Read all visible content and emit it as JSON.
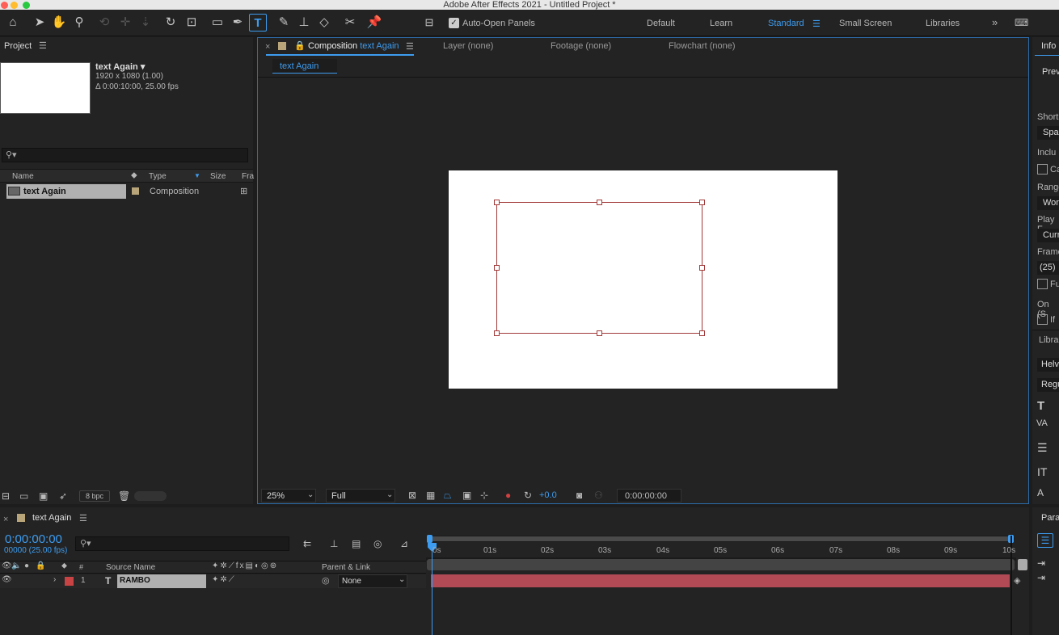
{
  "window": {
    "title": "Adobe After Effects 2021 - Untitled Project *"
  },
  "toolbar": {
    "auto_open_label": "Auto-Open Panels",
    "workspaces": [
      "Default",
      "Learn",
      "Standard",
      "Small Screen",
      "Libraries"
    ],
    "active_workspace": "Standard"
  },
  "project": {
    "panel_title": "Project",
    "comp_name": "text Again ▾",
    "comp_size": "1920 x 1080 (1.00)",
    "comp_duration": "Δ 0:00:10:00, 25.00 fps",
    "columns": [
      "Name",
      "Type",
      "Size",
      "Fra"
    ],
    "items": [
      {
        "name": "text Again",
        "type": "Composition"
      }
    ],
    "bpc": "8 bpc"
  },
  "viewer": {
    "comp_tab_prefix": "Composition",
    "comp_tab_name": "text Again",
    "layer_tab": "Layer (none)",
    "footage_tab": "Footage (none)",
    "flowchart_tab": "Flowchart (none)",
    "breadcrumb": "text Again",
    "zoom": "25%",
    "resolution": "Full",
    "exposure": "+0.0",
    "timecode": "0:00:00:00"
  },
  "info_panel": {
    "tab": "Info",
    "rows": [
      "Prev",
      "Short",
      "Spac",
      "Inclu",
      "Ca",
      "Range",
      "Wor",
      "Play F",
      "Curr",
      "Frame",
      "(25)",
      "Fu",
      "On (S",
      "If",
      "Libra",
      "Helv",
      "Regu"
    ]
  },
  "timeline": {
    "comp_name": "text Again",
    "timecode": "0:00:00:00",
    "frames": "00000 (25.00 fps)",
    "col_source_name": "Source Name",
    "col_parent": "Parent & Link",
    "col_number": "#",
    "ticks": [
      "0s",
      "01s",
      "02s",
      "03s",
      "04s",
      "05s",
      "06s",
      "07s",
      "08s",
      "09s",
      "10s"
    ],
    "layer": {
      "index": "1",
      "type_icon": "T",
      "name": "RAMBO",
      "parent": "None"
    },
    "paragraph_tab": "Para"
  }
}
